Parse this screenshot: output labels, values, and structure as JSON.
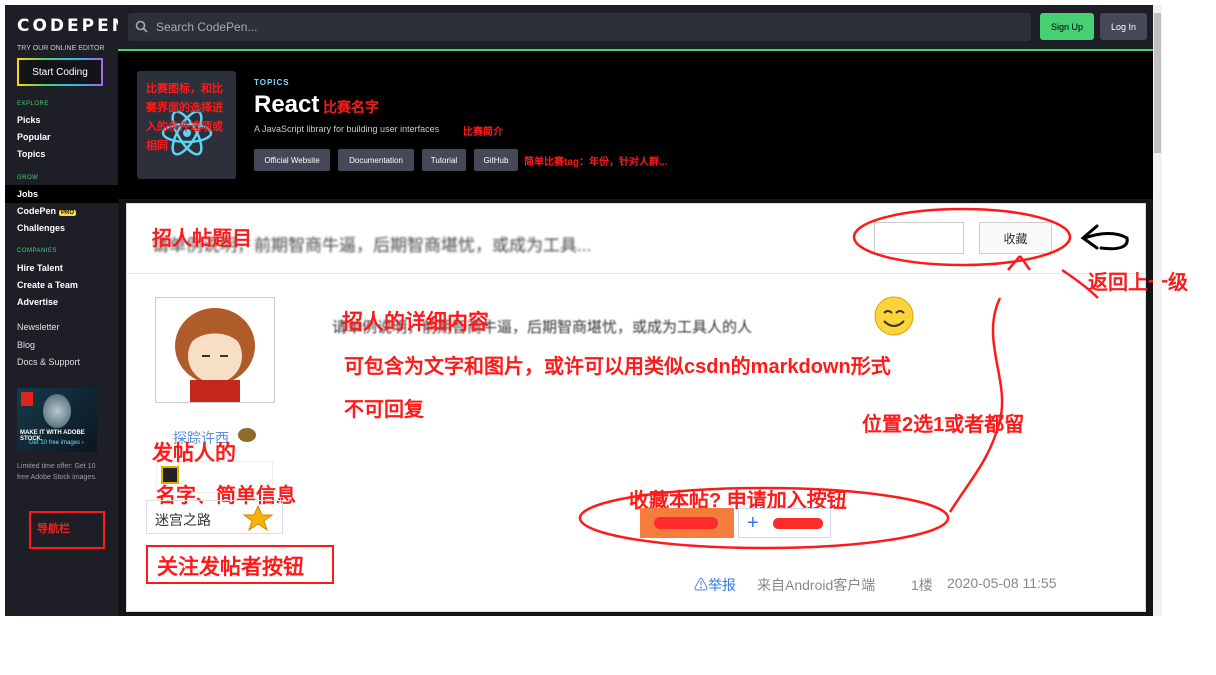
{
  "brand": {
    "logo": "CODEPEN",
    "tagline": "TRY OUR ONLINE EDITOR",
    "start_label": "Start Coding"
  },
  "sidebar": {
    "explore_heading": "EXPLORE",
    "explore": [
      "Picks",
      "Popular",
      "Topics"
    ],
    "grow_heading": "GROW",
    "jobs": "Jobs",
    "codepen": "CodePen",
    "pro_badge": "PRO",
    "challenges": "Challenges",
    "companies_heading": "COMPANIES",
    "companies": [
      "Hire Talent",
      "Create a Team",
      "Advertise"
    ],
    "misc": [
      "Newsletter",
      "Blog",
      "Docs & Support"
    ],
    "ad_headline": "MAKE IT WITH ADOBE STOCK.",
    "ad_cta": "Get 10 free images ›",
    "ad_caption": "Limited time offer: Get 10 free Adobe Stock images."
  },
  "header": {
    "search_placeholder": "Search CodePen...",
    "signup": "Sign Up",
    "login": "Log In"
  },
  "hero": {
    "topics_label": "TOPICS",
    "title": "React",
    "subtitle": "A JavaScript library for building user interfaces",
    "links": [
      "Official Website",
      "Documentation",
      "Tutorial",
      "GitHub"
    ]
  },
  "post": {
    "title_text": "请单例说明，前期智商牛逼，后期智商堪忧，或成为工具...",
    "fav_button": "收藏",
    "body_text": "请单例说明，前期智商牛逼，后期智商堪忧，或成为工具人的人",
    "author_name": "探踪许西",
    "chip_text": "迷宫之路",
    "report": "举报",
    "source": "来自Android客户端",
    "floor": "1楼",
    "date": "2020-05-08 11:55"
  },
  "annotations": {
    "icon_note": "比赛图标，和比赛界面的选择进入的条件选项或相同",
    "name_note": "比赛名字",
    "intro_note": "比赛简介",
    "tag_note": "简单比赛tag：年份，针对人群...",
    "post_title_note": "招人帖题目",
    "back_note": "返回上一级",
    "detail_note": "招人的详细内容",
    "detail_note2": "可包含为文字和图片，或许可以用类似csdn的markdown形式",
    "detail_note3": "不可回复",
    "position_note": "位置2选1或者都留",
    "author_note": "发帖人的",
    "author_note2": "名字、简单信息",
    "buttons_note": "收藏本帖? 申请加入按钮",
    "follow_note": "关注发帖者按钮",
    "nav_note": "导航栏"
  },
  "colors": {
    "accent_green": "#47cf73",
    "annotation_red": "#ff1a1a",
    "dark_bg": "#131417"
  }
}
